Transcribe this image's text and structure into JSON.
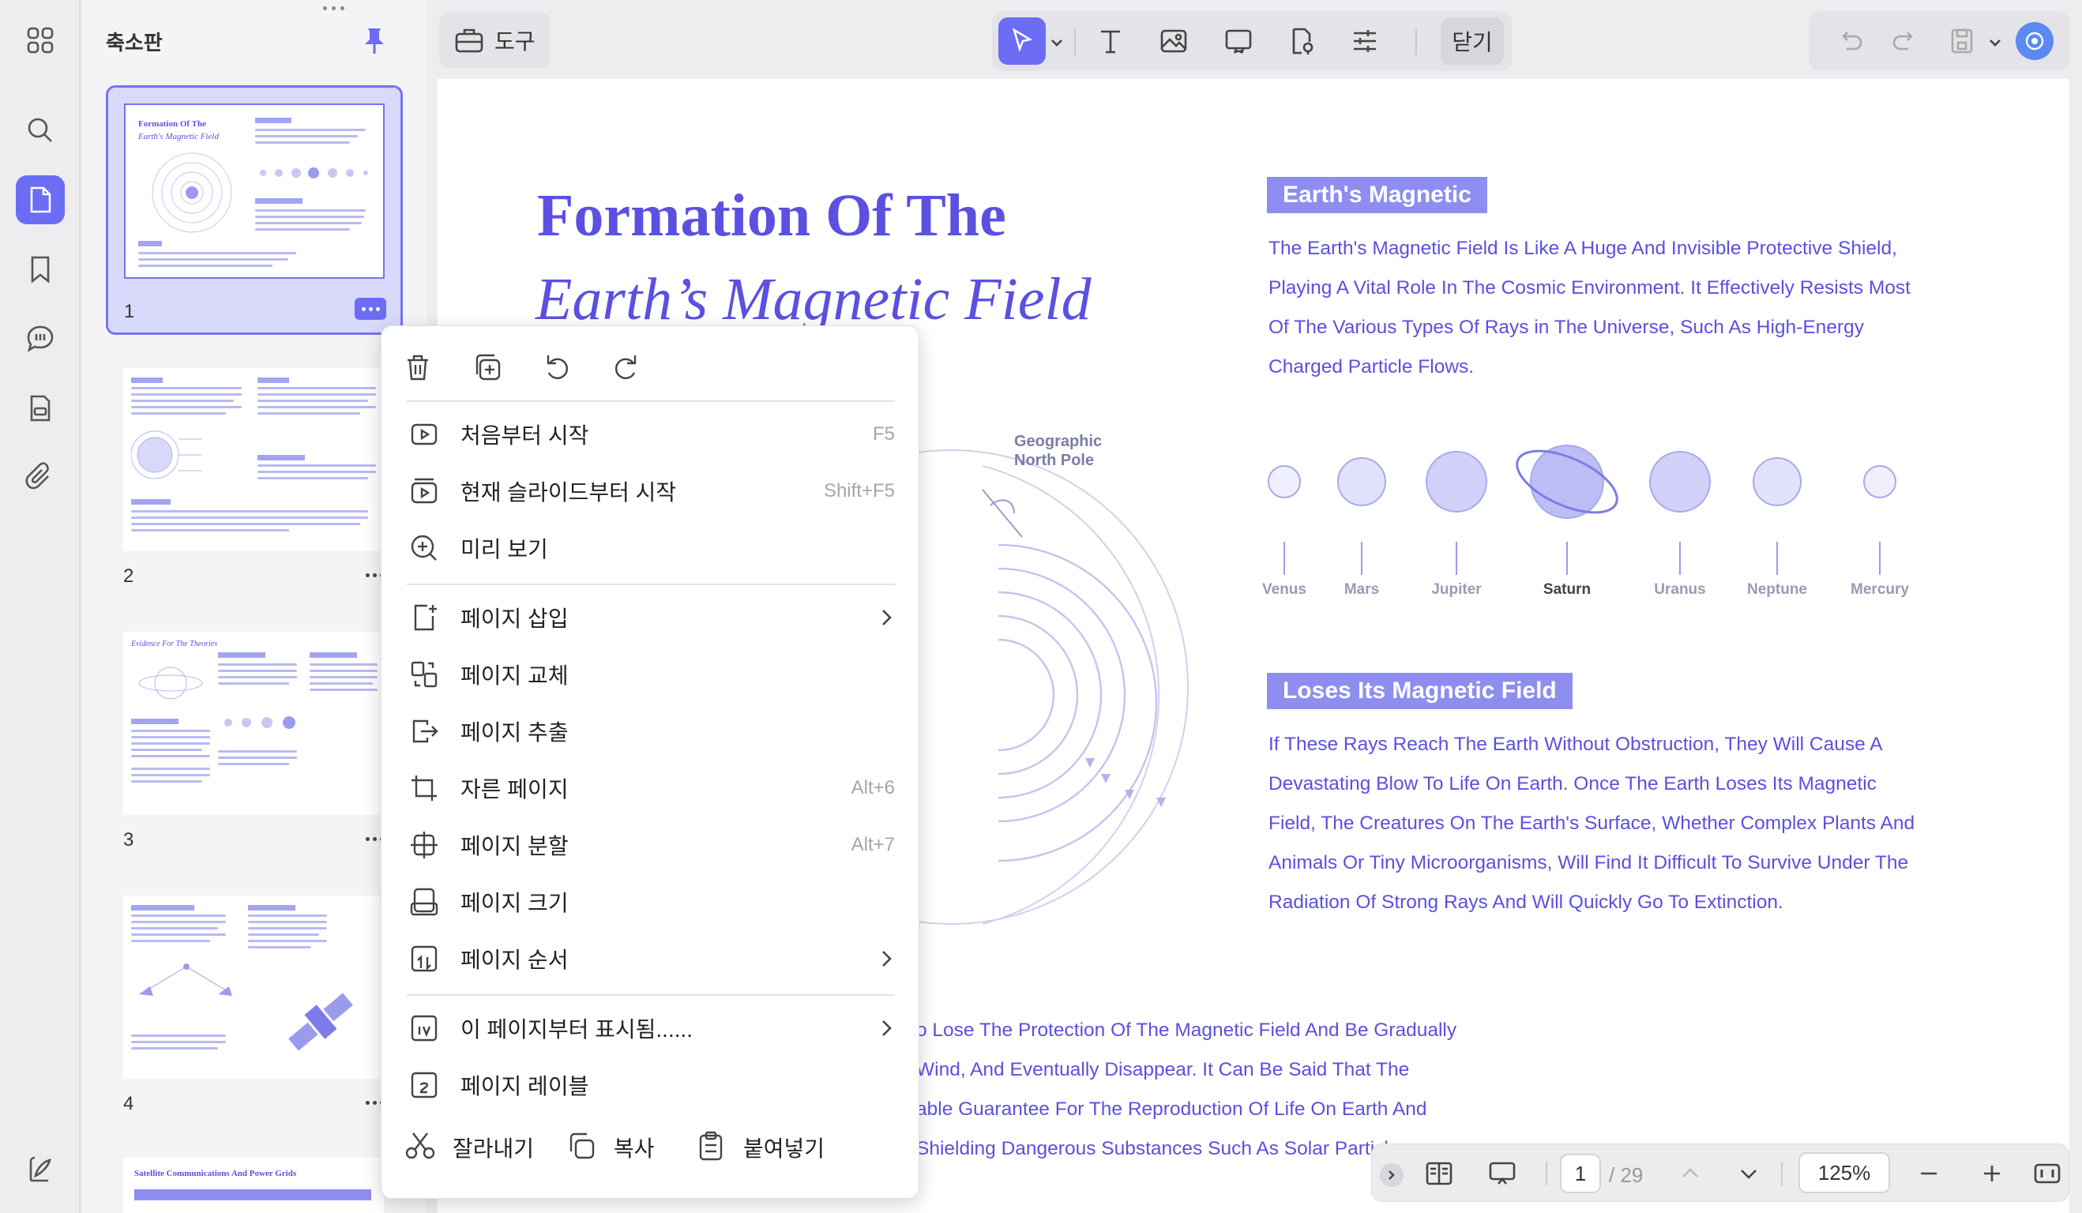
{
  "panel": {
    "title": "축소판"
  },
  "toolbar": {
    "tools_label": "도구",
    "close_label": "닫기"
  },
  "thumbnails": [
    {
      "number": "1",
      "title": "Formation Of The",
      "subtitle": "Earth's Magnetic Field"
    },
    {
      "number": "2"
    },
    {
      "number": "3",
      "title": "Evidence For The Theories"
    },
    {
      "number": "4"
    },
    {
      "title": "Satellite Communications And Power Grids"
    }
  ],
  "document": {
    "title_line1": "Formation Of The",
    "title_line2": "Earth’s Magnetic Field",
    "section1_tag": "Earth's Magnetic",
    "section1_lines": [
      "The Earth's Magnetic Field Is Like A Huge And Invisible Protective Shield,",
      "Playing A Vital Role In The Cosmic Environment. It Effectively Resists Most",
      "Of The Various Types Of Rays in The Universe, Such As High-Energy",
      "Charged Particle Flows."
    ],
    "north_pole_label_1": "Geographic",
    "north_pole_label_2": "North Pole",
    "planets": [
      "Venus",
      "Mars",
      "Jupiter",
      "Saturn",
      "Uranus",
      "Neptune",
      "Mercury"
    ],
    "section2_tag": "Loses Its Magnetic Field",
    "section2_lines": [
      "If These Rays Reach The Earth Without Obstruction, They Will Cause A",
      "Devastating Blow To Life On Earth. Once The Earth Loses Its Magnetic",
      "Field, The Creatures On The Earth's Surface, Whether Complex Plants And",
      "Animals Or Tiny Microorganisms, Will Find It Difficult To Survive Under The",
      "Radiation Of Strong Rays And Will Quickly Go To Extinction."
    ],
    "bottom_lines": [
      "o Lose The Protection Of The Magnetic Field And Be Gradually",
      "Wind, And Eventually Disappear. It Can Be Said That The",
      "able Guarantee For The Reproduction Of Life On Earth And",
      "Shielding Dangerous Substances Such As Solar Particl"
    ]
  },
  "bottom_bar": {
    "page": "1",
    "total": "/ 29",
    "zoom": "125%"
  },
  "context_menu": {
    "items": [
      {
        "label": "처음부터 시작",
        "shortcut": "F5"
      },
      {
        "label": "현재 슬라이드부터 시작",
        "shortcut": "Shift+F5"
      },
      {
        "label": "미리 보기",
        "shortcut": ""
      },
      {
        "label": "페이지 삽입",
        "shortcut": ""
      },
      {
        "label": "페이지 교체",
        "shortcut": ""
      },
      {
        "label": "페이지 추출",
        "shortcut": ""
      },
      {
        "label": "자른 페이지",
        "shortcut": "Alt+6"
      },
      {
        "label": "페이지 분할",
        "shortcut": "Alt+7"
      },
      {
        "label": "페이지 크기",
        "shortcut": ""
      },
      {
        "label": "페이지 순서",
        "shortcut": ""
      },
      {
        "label": "이 페이지부터 표시됨......",
        "shortcut": ""
      },
      {
        "label": "페이지 레이블",
        "shortcut": ""
      }
    ],
    "cut": "잘라내기",
    "copy": "복사",
    "paste": "붙여넣기"
  },
  "colors": {
    "accent": "#6c6cf5",
    "doc_text": "#5b50e0",
    "tag_bg": "#8e8ef0"
  }
}
